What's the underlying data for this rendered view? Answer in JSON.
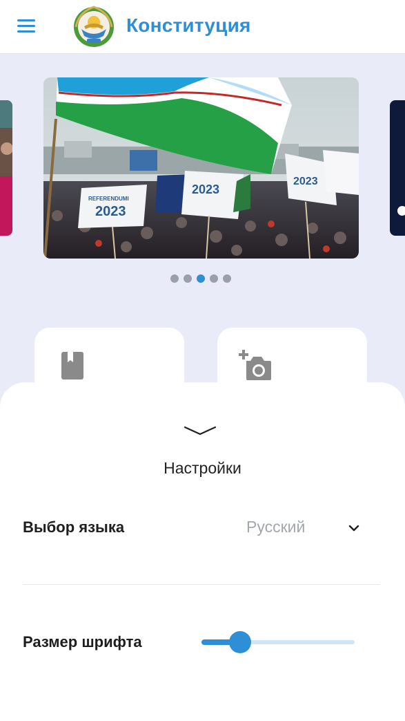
{
  "header": {
    "title": "Конституция",
    "menu_icon": "hamburger-menu-icon",
    "emblem_icon": "state-emblem-icon"
  },
  "carousel": {
    "slide_count": 5,
    "active_index": 2,
    "main_slide": "rally-with-flags-2023-photo",
    "flag_text": [
      "REFERENDUMI",
      "2023"
    ]
  },
  "tiles": [
    {
      "icon": "bookmark-icon"
    },
    {
      "icon": "add-photo-icon"
    }
  ],
  "settings": {
    "collapse_icon": "chevron-down-icon",
    "title": "Настройки",
    "language": {
      "label": "Выбор языка",
      "value": "Русский",
      "icon": "chevron-down-icon"
    },
    "font_size": {
      "label": "Размер шрифта",
      "level": 0.25
    }
  },
  "colors": {
    "accent": "#2f8fd6",
    "background": "#e9ecf8",
    "muted_text": "#a2a6ad",
    "slider_track": "#cfe6f8"
  }
}
